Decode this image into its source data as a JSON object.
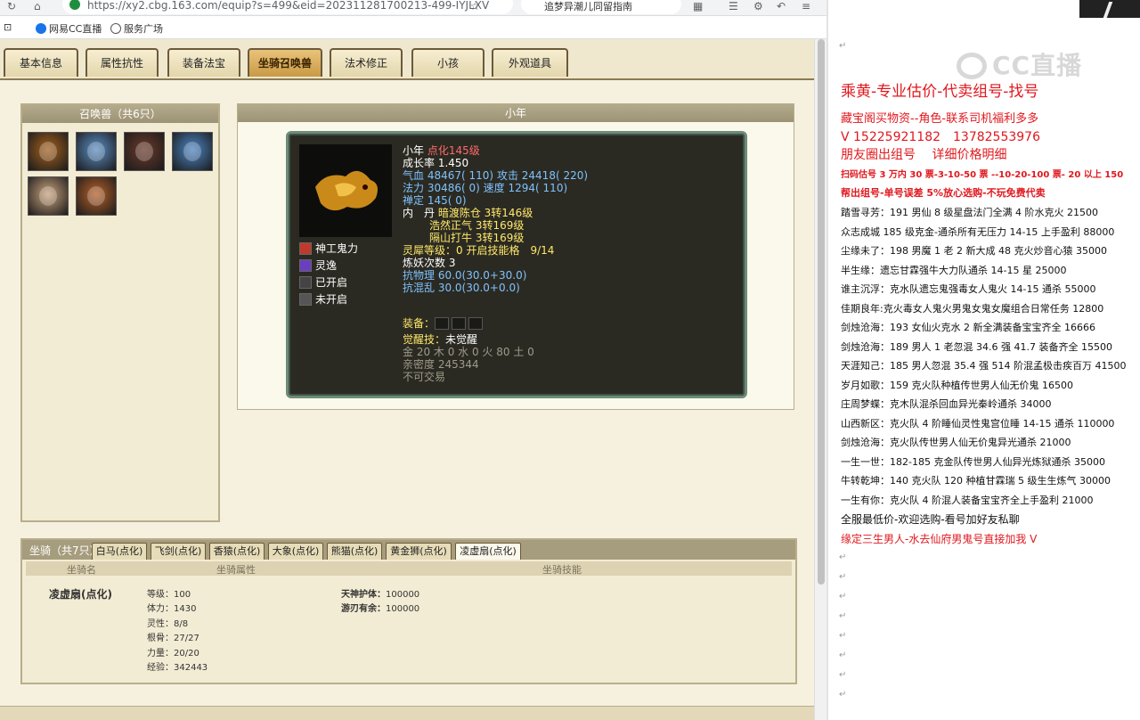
{
  "browser": {
    "url": "https://xy2.cbg.163.com/equip?s=499&eid=202311281700213-499-IYJLXV",
    "search_text": "追梦异潮儿同留指南",
    "bookmarks": [
      "网易CC直播",
      "服务广场"
    ],
    "colors": {
      "lock": "#1e8e3e"
    }
  },
  "tabs": [
    "基本信息",
    "属性抗性",
    "装备法宝",
    "坐骑召唤兽",
    "法术修正",
    "小孩",
    "外观道具"
  ],
  "active_tab": "坐骑召唤兽",
  "pet_list": {
    "title": "召唤兽（共6只）",
    "pets": [
      {
        "icon": "golden-beast-icon",
        "color": "#a5621f"
      },
      {
        "icon": "ice-spirit-icon",
        "color": "#5d8fc6"
      },
      {
        "icon": "warrior-figure-icon",
        "color": "#6b3b2b"
      },
      {
        "icon": "ice-spirit-icon",
        "color": "#4d86c4"
      },
      {
        "icon": "girl-portrait-icon",
        "color": "#c8a27c"
      },
      {
        "icon": "flame-beast-icon",
        "color": "#b5602a"
      }
    ]
  },
  "pet_detail": {
    "header": "小年",
    "name": "小年",
    "tag": "点化145级",
    "growth": "成长率 1.450",
    "hp_label": "气血",
    "hp_value": "48467( 110)",
    "attack_label": "攻击",
    "attack_value": "24418( 220)",
    "mana_label": "法力",
    "mana_value": "30486( 0)",
    "speed_label": "速度",
    "speed_value": "1294( 110)",
    "focus": "禅定 145( 0)",
    "inner_label": "内　丹",
    "inner_1": "暗渡陈仓 3转146级",
    "inner_2": "浩然正气 3转169级",
    "inner_3": "隔山打牛 3转169级",
    "spirit_level": "灵犀等级：0 开启技能格　9/14",
    "refine": "炼妖次数 3",
    "phys_resist": "抗物理 60.0(30.0+30.0)",
    "chaos_resist": "抗混乱 30.0(30.0+0.0)",
    "equip_label": "装备：",
    "awaken_label": "觉醒技：",
    "awaken_value": "未觉醒",
    "elements": "金 20 木 0 水 0 火 80 土 0",
    "intimacy": "亲密度 245344",
    "tradable": "不可交易",
    "skills": [
      {
        "icon": "demon-power-icon",
        "name": "神工鬼力",
        "color": "#c0392b"
      },
      {
        "icon": "spirit-escape-icon",
        "name": "灵逸",
        "color": "#6a3fbf"
      },
      {
        "icon": "skill-slot-icon",
        "name": "已开启",
        "color": "#444"
      },
      {
        "icon": "locked-slot-icon",
        "name": "未开启",
        "color": "#555"
      }
    ]
  },
  "mounts": {
    "title": "坐骑（共7只）",
    "tabs": [
      "白马(点化)",
      "飞剑(点化)",
      "香猿(点化)",
      "大象(点化)",
      "熊猫(点化)",
      "黄金狮(点化)",
      "凌虚扇(点化)"
    ],
    "active": "凌虚扇(点化)",
    "headers": [
      "坐骑名",
      "坐骑属性",
      "坐骑技能"
    ],
    "name": "凌虚扇(点化)",
    "attrs": [
      "等级：100",
      "体力：1430",
      "灵性：8/8",
      "根骨：27/27",
      "力量：20/20",
      "经验：342443"
    ],
    "skills": [
      {
        "name": "天神护体：",
        "value": "100000"
      },
      {
        "name": "游刃有余：",
        "value": "100000"
      }
    ]
  },
  "overlay": {
    "logo": "CC直播",
    "title": "乘黄-专业估价-代卖组号-找号",
    "line1": "藏宝阁买物资--角色-联系司机福利多多",
    "line2": "V 15225921182　13782553976",
    "line3": "朋友圈出组号　 详细价格明细",
    "line4": "扫码估号 3 万内 30 票-3-10-50 票 --10-20-100 票- 20 以上 150",
    "line5": "帮出组号-单号误差 5%放心选购-不玩免费代卖",
    "listings": [
      "踏雪寻芳：191 男仙 8 级星盘法门全满 4 阶水克火 21500",
      "众志成城 185 级克金-通杀所有无压力 14-15 上手盈利 88000",
      "尘缘未了：198 男魔 1 老 2 新大成 48 克火炒音心猿 35000",
      "半生缘：遗忘甘霖强牛大力队通杀 14-15 星 25000",
      "谁主沉浮：克水队遗忘鬼强毒女人鬼火 14-15 通杀 55000",
      "佳期良年:克火毒女人鬼火男鬼女鬼女魔组合日常任务 12800",
      "剑烛沧海：193 女仙火克水 2 新全满装备宝宝齐全 16666",
      "剑烛沧海：189 男人 1 老忽混 34.6 强 41.7 装备齐全 15500",
      "天涯知己：185 男人忽混 35.4 强 514 阶混孟极击疾百万 41500",
      "岁月如歌：159 克火队种植传世男人仙无价鬼 16500",
      "庄周梦蝶：克木队混杀回血异光秦岭通杀 34000",
      "山西新区：克火队 4 阶睡仙灵性鬼宫位睡 14-15 通杀 110000",
      "剑烛沧海：克火队传世男人仙无价鬼异光通杀 21000",
      "一生一世：182-185 克金队传世男人仙异光炼狱通杀 35000",
      "牛转乾坤：140 克火队 120 种植甘霖瑞 5 级生生炼气 30000",
      "一生有你：克火队 4 阶混人装备宝宝齐全上手盈利 21000"
    ],
    "footer1": "全服最低价-欢迎选购-看号加好友私聊",
    "footer2": "缘定三生男人-水去仙府男鬼号直接加我 V",
    "colors": {
      "red": "#e0181e",
      "text": "#111111"
    }
  }
}
